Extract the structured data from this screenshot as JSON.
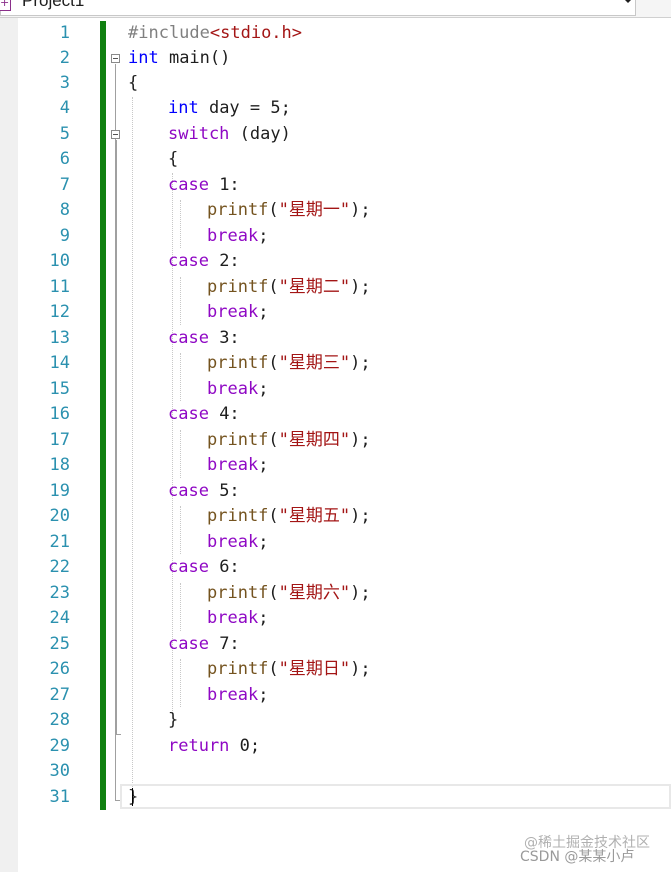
{
  "navbar": {
    "project_name": "Project1"
  },
  "editor": {
    "line_numbers": [
      "1",
      "2",
      "3",
      "4",
      "5",
      "6",
      "7",
      "8",
      "9",
      "10",
      "11",
      "12",
      "13",
      "14",
      "15",
      "16",
      "17",
      "18",
      "19",
      "20",
      "21",
      "22",
      "23",
      "24",
      "25",
      "26",
      "27",
      "28",
      "29",
      "30",
      "31"
    ],
    "tokens": {
      "l1_directive": "#include",
      "l1_header": "<stdio.h>",
      "l2_kw": "int",
      "l2_rest": " main()",
      "l3": "{",
      "l4_kw": "int",
      "l4_rest": " day = 5;",
      "l5_kw": "switch",
      "l5_rest": " (day)",
      "l6": "{",
      "case_kw": "case",
      "case1_rest": " 1:",
      "case2_rest": " 2:",
      "case3_rest": " 3:",
      "case4_rest": " 4:",
      "case5_rest": " 5:",
      "case6_rest": " 6:",
      "case7_rest": " 7:",
      "printf": "printf",
      "open_paren": "(",
      "close_semi": ");",
      "str1": "\"星期一\"",
      "str2": "\"星期二\"",
      "str3": "\"星期三\"",
      "str4": "\"星期四\"",
      "str5": "\"星期五\"",
      "str6": "\"星期六\"",
      "str7": "\"星期日\"",
      "break_kw": "break",
      "semi": ";",
      "l28": "}",
      "l29_kw": "return",
      "l29_rest": " 0;",
      "l31": "}"
    }
  },
  "watermark": {
    "line1": "@稀土掘金技术社区",
    "line2": "CSDN @某某小卢"
  }
}
